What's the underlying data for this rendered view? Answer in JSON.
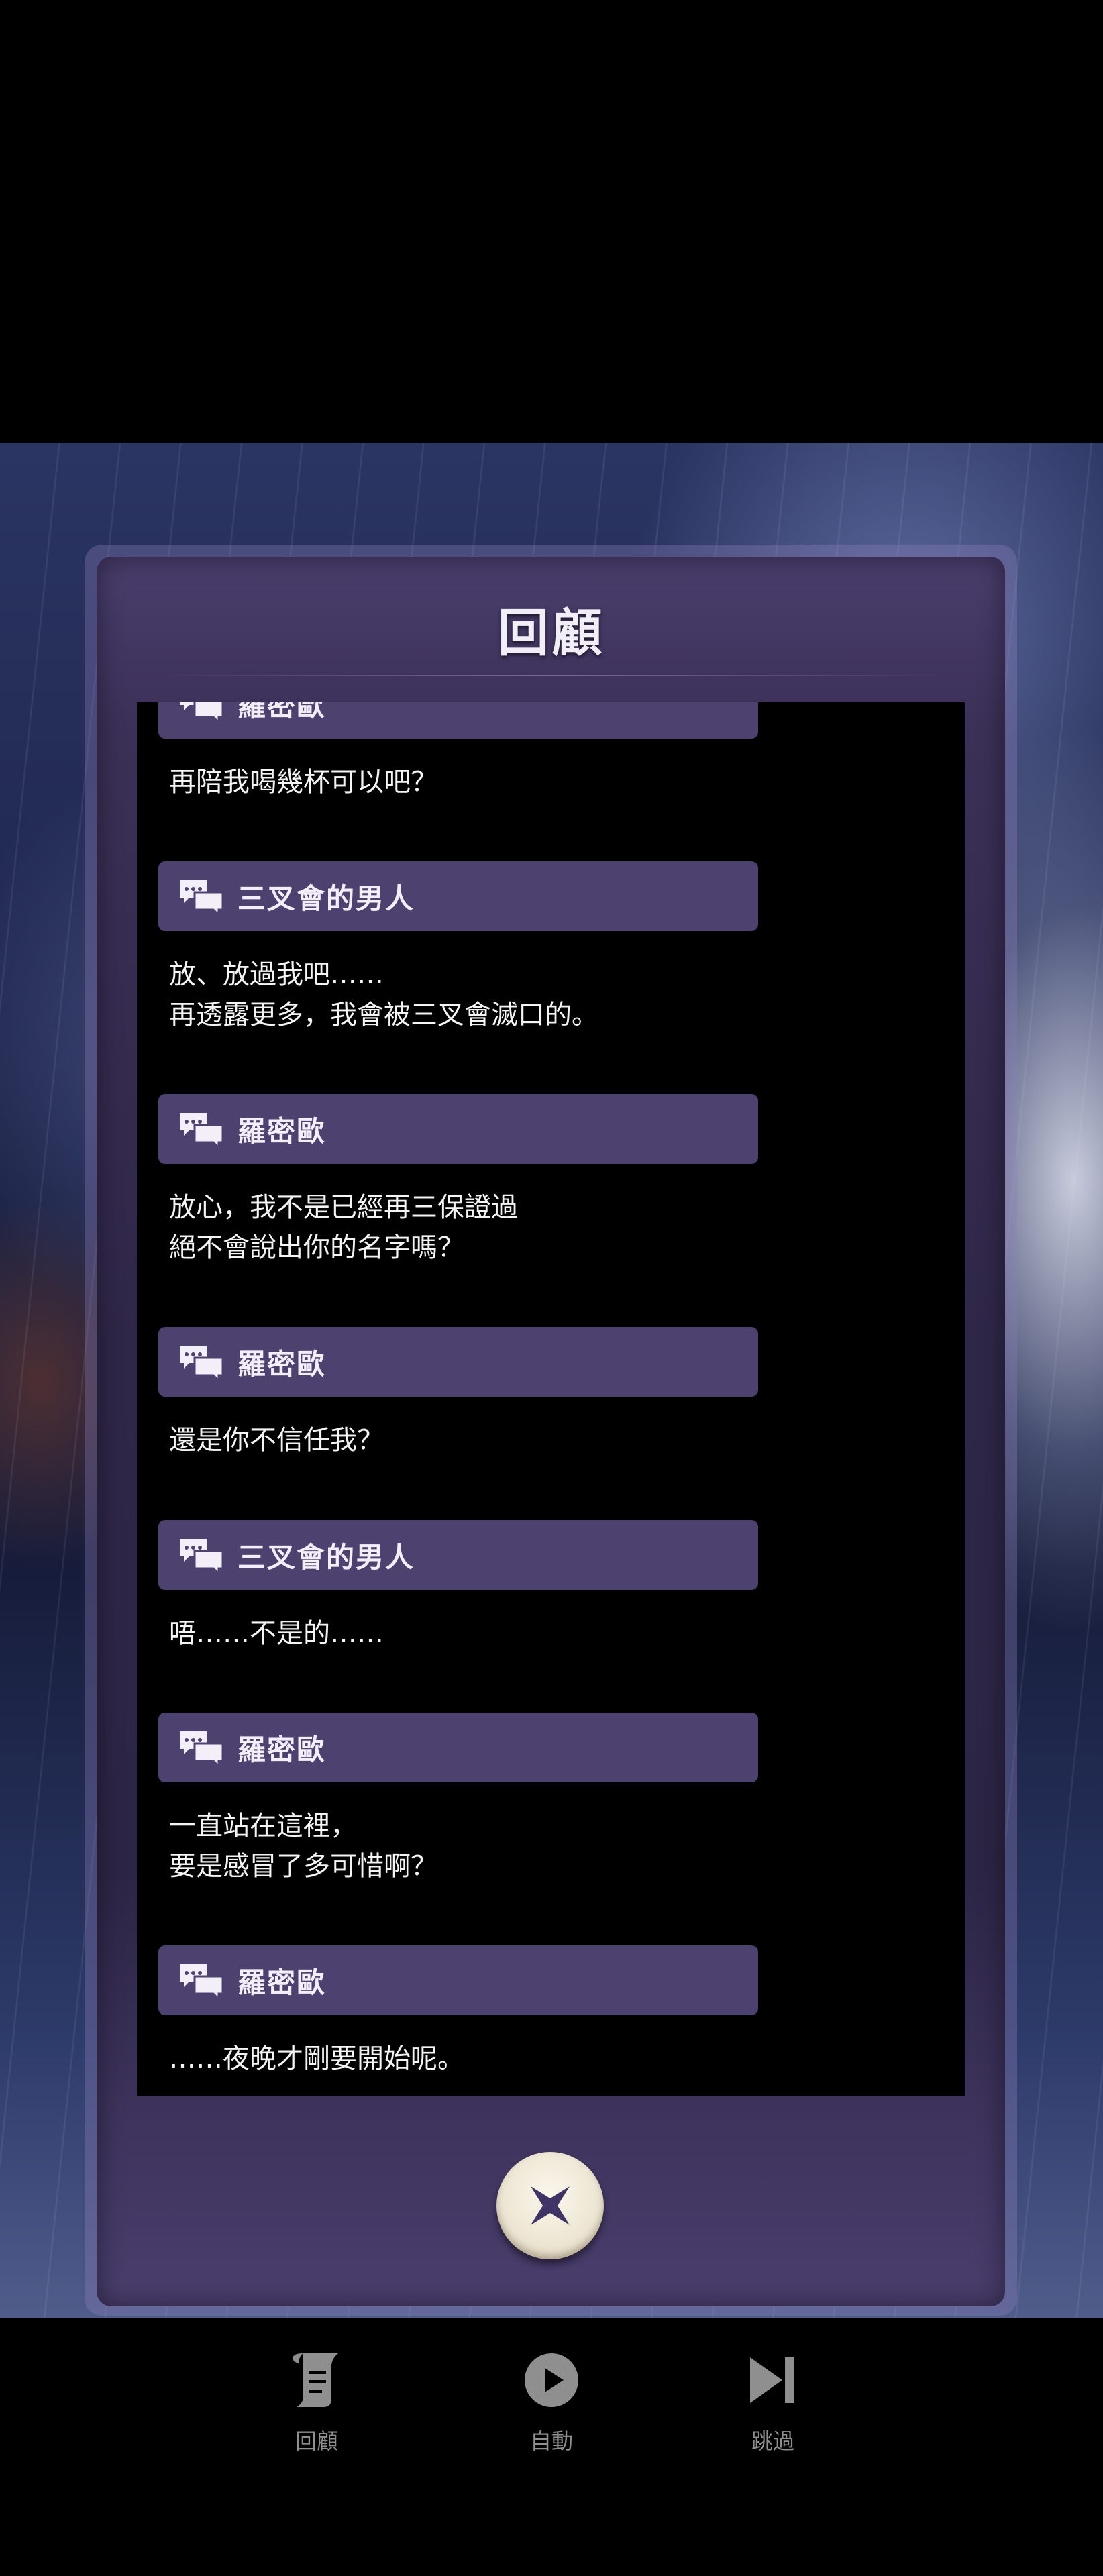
{
  "panel": {
    "title": "回顧",
    "close_icon": "close-x-icon"
  },
  "log": [
    {
      "speaker": "羅密歐",
      "lines": [
        "再陪我喝幾杯可以吧？"
      ]
    },
    {
      "speaker": "三叉會的男人",
      "lines": [
        "放、放過我吧……",
        "再透露更多，我會被三叉會滅口的。"
      ]
    },
    {
      "speaker": "羅密歐",
      "lines": [
        "放心，我不是已經再三保證過",
        "絕不會說出你的名字嗎？"
      ]
    },
    {
      "speaker": "羅密歐",
      "lines": [
        "還是你不信任我？"
      ]
    },
    {
      "speaker": "三叉會的男人",
      "lines": [
        "唔……不是的……"
      ]
    },
    {
      "speaker": "羅密歐",
      "lines": [
        "一直站在這裡，",
        "要是感冒了多可惜啊？"
      ]
    },
    {
      "speaker": "羅密歐",
      "lines": [
        "……夜晚才剛要開始呢。"
      ]
    }
  ],
  "bottom_bar": {
    "review_label": "回顧",
    "auto_label": "自動",
    "skip_label": "跳過",
    "review_icon": "scroll-icon",
    "auto_icon": "play-icon",
    "skip_icon": "skip-forward-icon"
  },
  "colors": {
    "name_bar": "#4d4170",
    "panel": "#2f2748",
    "bottom_label": "#8f8f8f"
  }
}
